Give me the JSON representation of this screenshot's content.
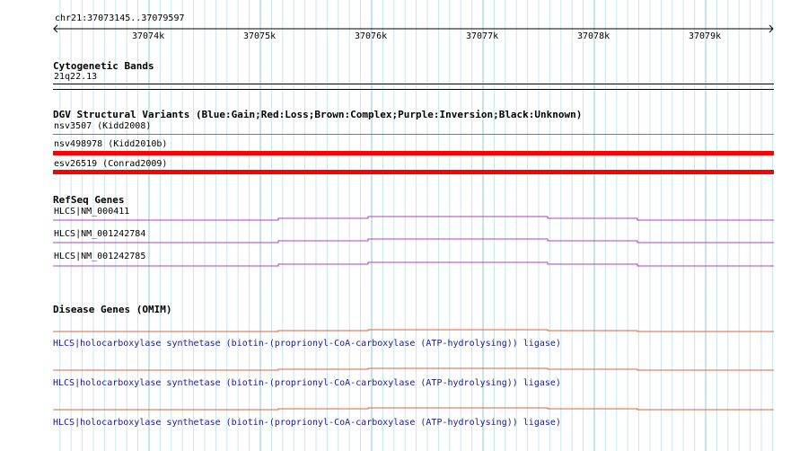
{
  "ruler": {
    "location": "chr21:37073145..37079597",
    "ticks": [
      "37074k",
      "37075k",
      "37076k",
      "37077k",
      "37078k",
      "37079k"
    ]
  },
  "cytoband": {
    "title": "Cytogenetic Bands",
    "band": "21q22.13"
  },
  "dgv": {
    "title": "DGV Structural Variants (Blue:Gain;Red:Loss;Brown:Complex;Purple:Inversion;Black:Unknown)",
    "variants": [
      {
        "label": "nsv3507 (Kidd2008)",
        "color": "#e85040"
      },
      {
        "label": "nsv498978 (Kidd2010b)",
        "color": "#ff0000"
      },
      {
        "label": "esv26519 (Conrad2009)",
        "color": "#ff0000"
      }
    ]
  },
  "refseq": {
    "title": "RefSeq Genes",
    "color": "#b040c0",
    "genes": [
      {
        "label": "HLCS|NM_000411"
      },
      {
        "label": "HLCS|NM_001242784"
      },
      {
        "label": "HLCS|NM_001242785"
      }
    ]
  },
  "omim": {
    "title": "Disease Genes (OMIM)",
    "color": "#e06040",
    "entries": [
      {
        "label": "HLCS|holocarboxylase synthetase (biotin-(proprionyl-CoA-carboxylase (ATP-hydrolysing)) ligase)"
      },
      {
        "label": "HLCS|holocarboxylase synthetase (biotin-(proprionyl-CoA-carboxylase (ATP-hydrolysing)) ligase)"
      },
      {
        "label": "HLCS|holocarboxylase synthetase (biotin-(proprionyl-CoA-carboxylase (ATP-hydrolysing)) ligase)"
      }
    ]
  },
  "colors": {
    "grid_major": "#8ec8d8",
    "grid_minor": "#c6e6ee"
  }
}
